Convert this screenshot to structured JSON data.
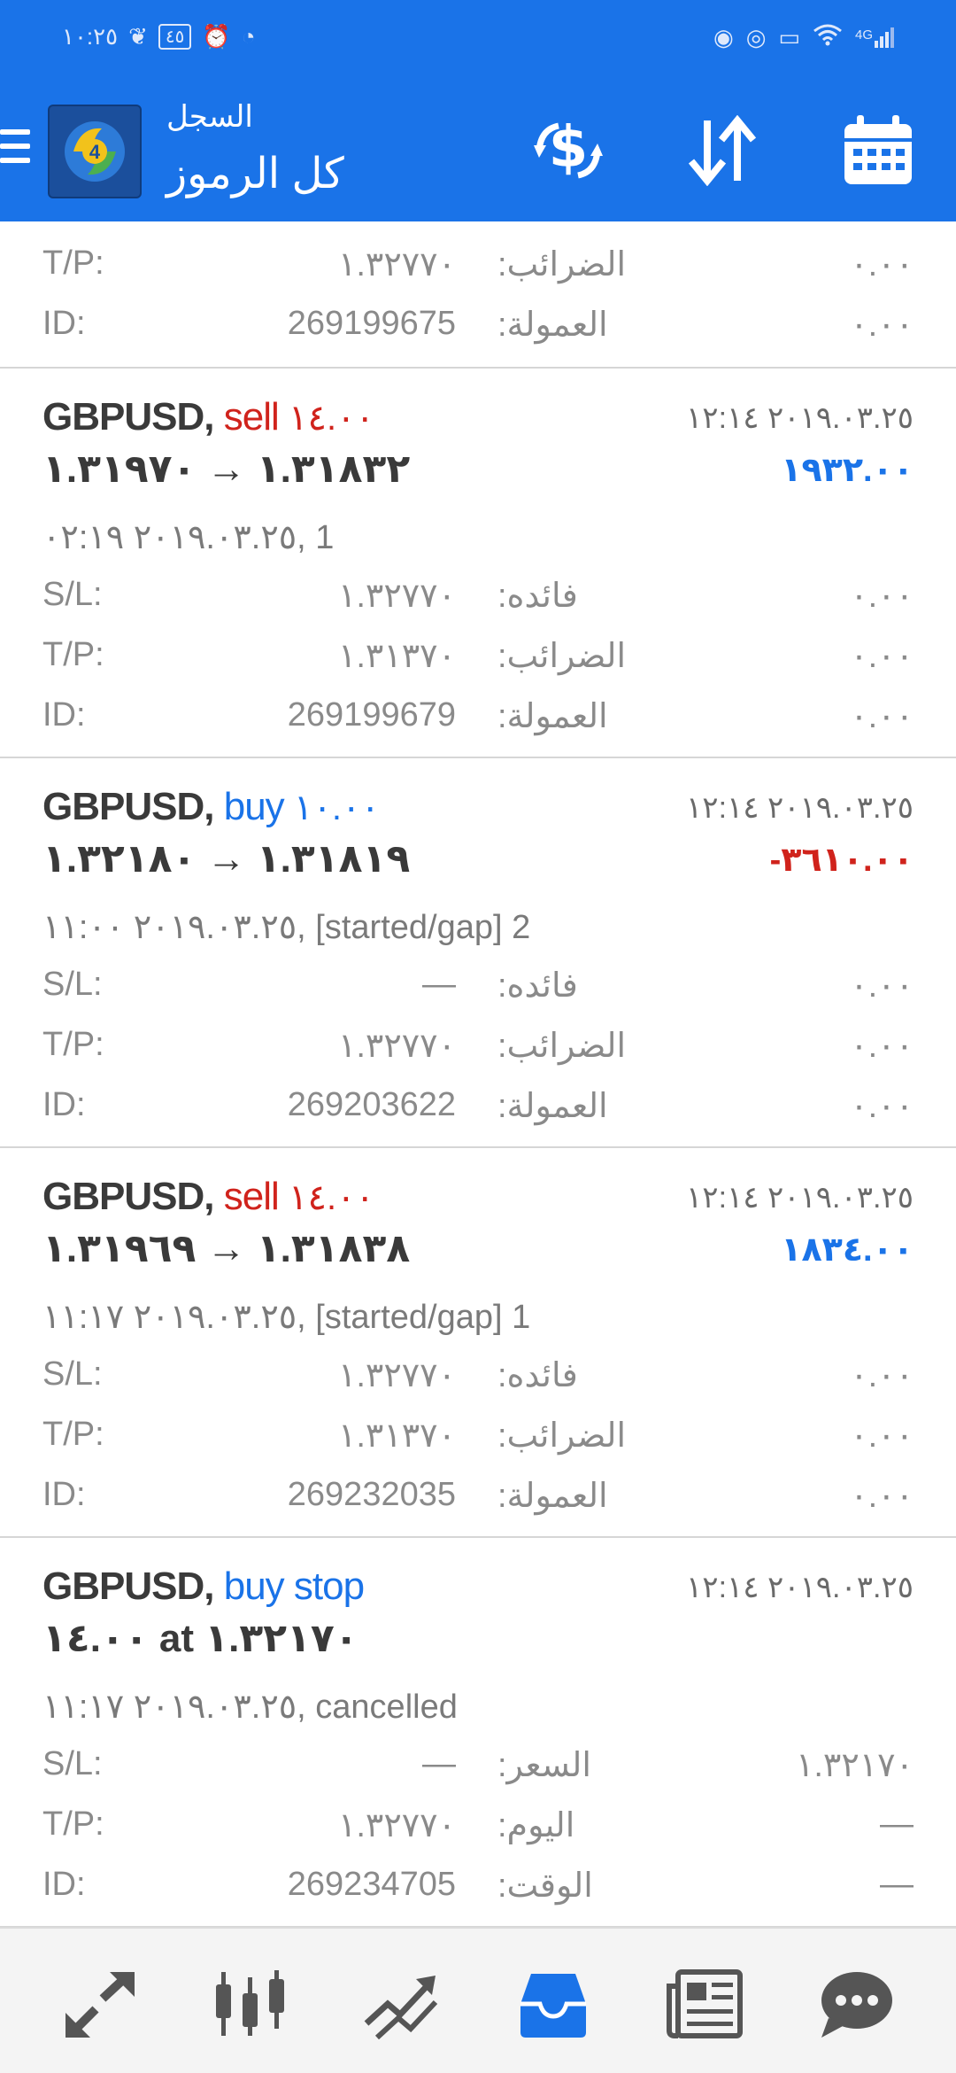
{
  "status_bar": {
    "time": "١٠:٢٥",
    "battery": "٤٥",
    "left_icons": [
      "leaf-icon",
      "battery-icon",
      "alarm-icon",
      "data-saver-icon"
    ],
    "right_icons": [
      "messenger-icon",
      "app-icon",
      "cast-icon",
      "wifi-icon",
      "signal-icon"
    ],
    "network": "4G"
  },
  "app_bar": {
    "subtitle": "السجل",
    "title": "كل الرموز",
    "logo_text": "4"
  },
  "partial": {
    "tp_key": "T/P:",
    "tp_value": "١.٣٢٧٧٠",
    "tp_label": "الضرائب:",
    "tp_right": "٠.٠٠",
    "id_key": "ID:",
    "id_value": "269199675",
    "id_label": "العمولة:",
    "id_right": "٠.٠٠"
  },
  "orders": [
    {
      "symbol": "GBPUSD,",
      "type": "sell",
      "volume": "١٤.٠٠",
      "prices": "١.٣١٨٣٢ → ١.٣١٩٧٠",
      "date": "٢٠١٩.٠٣.٢٥ ١٢:١٤",
      "profit": "١٩٣٢.٠٠",
      "comment": "٢٠١٩.٠٣.٢٥ ٠٢:١٩, 1",
      "sl_key": "S/L:",
      "sl_value": "١.٣٢٧٧٠",
      "sl_label": "فائده:",
      "sl_right": "٠.٠٠",
      "tp_key": "T/P:",
      "tp_value": "١.٣١٣٧٠",
      "tp_label": "الضرائب:",
      "tp_right": "٠.٠٠",
      "id_key": "ID:",
      "id_value": "269199679",
      "id_label": "العمولة:",
      "id_right": "٠.٠٠"
    },
    {
      "symbol": "GBPUSD,",
      "type": "buy",
      "volume": "١٠.٠٠",
      "prices": "١.٣١٨١٩ → ١.٣٢١٨٠",
      "date": "٢٠١٩.٠٣.٢٥ ١٢:١٤",
      "profit": "-٣٦١٠.٠٠",
      "comment": "٢٠١٩.٠٣.٢٥ ١١:٠٠, [started/gap] 2",
      "sl_key": "S/L:",
      "sl_value": "—",
      "sl_label": "فائده:",
      "sl_right": "٠.٠٠",
      "tp_key": "T/P:",
      "tp_value": "١.٣٢٧٧٠",
      "tp_label": "الضرائب:",
      "tp_right": "٠.٠٠",
      "id_key": "ID:",
      "id_value": "269203622",
      "id_label": "العمولة:",
      "id_right": "٠.٠٠"
    },
    {
      "symbol": "GBPUSD,",
      "type": "sell",
      "volume": "١٤.٠٠",
      "prices": "١.٣١٨٣٨ → ١.٣١٩٦٩",
      "date": "٢٠١٩.٠٣.٢٥ ١٢:١٤",
      "profit": "١٨٣٤.٠٠",
      "comment": "٢٠١٩.٠٣.٢٥ ١١:١٧, [started/gap] 1",
      "sl_key": "S/L:",
      "sl_value": "١.٣٢٧٧٠",
      "sl_label": "فائده:",
      "sl_right": "٠.٠٠",
      "tp_key": "T/P:",
      "tp_value": "١.٣١٣٧٠",
      "tp_label": "الضرائب:",
      "tp_right": "٠.٠٠",
      "id_key": "ID:",
      "id_value": "269232035",
      "id_label": "العمولة:",
      "id_right": "٠.٠٠"
    },
    {
      "symbol": "GBPUSD,",
      "type": "buy stop",
      "volume": "",
      "prices": "١٤.٠٠ at ١.٣٢١٧٠",
      "date": "٢٠١٩.٠٣.٢٥ ١٢:١٤",
      "profit": "",
      "comment": "٢٠١٩.٠٣.٢٥ ١١:١٧, cancelled",
      "sl_key": "S/L:",
      "sl_value": "—",
      "sl_label": "السعر:",
      "sl_right": "١.٣٢١٧٠",
      "tp_key": "T/P:",
      "tp_value": "١.٣٢٧٧٠",
      "tp_label": "اليوم:",
      "tp_right": "—",
      "id_key": "ID:",
      "id_value": "269234705",
      "id_label": "الوقت:",
      "id_right": "—"
    }
  ],
  "bottom_nav": [
    {
      "name": "quotes",
      "icon": "arrows-icon"
    },
    {
      "name": "chart",
      "icon": "candlestick-icon"
    },
    {
      "name": "trade",
      "icon": "trend-icon"
    },
    {
      "name": "history",
      "icon": "inbox-icon",
      "active": true
    },
    {
      "name": "news",
      "icon": "newspaper-icon"
    },
    {
      "name": "chat",
      "icon": "chat-bubble-icon"
    }
  ],
  "colors": {
    "accent": "#1a73e8",
    "sell": "#d0231c",
    "profit_positive": "#1a73e8",
    "profit_negative": "#d0231c"
  }
}
